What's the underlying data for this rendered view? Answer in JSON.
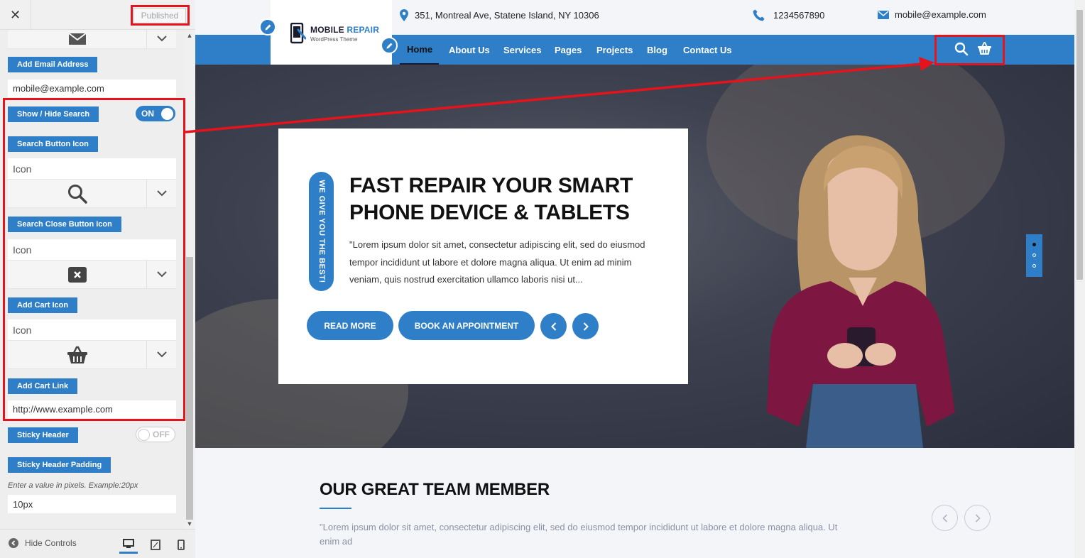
{
  "customizer": {
    "close_glyph": "✕",
    "published_label": "Published",
    "email_field_label": "Add Email Address",
    "email_value": "mobile@example.com",
    "show_hide_search_label": "Show / Hide Search",
    "search_toggle_state": "ON",
    "search_button_icon_label": "Search Button Icon",
    "search_icon_placeholder": "Icon",
    "search_close_icon_label": "Search Close Button Icon",
    "search_close_icon_placeholder": "Icon",
    "cart_icon_label": "Add Cart Icon",
    "cart_icon_placeholder": "Icon",
    "cart_link_label": "Add Cart Link",
    "cart_link_value": "http://www.example.com",
    "sticky_header_label": "Sticky Header",
    "sticky_toggle_state": "OFF",
    "sticky_padding_label": "Sticky Header Padding",
    "sticky_padding_hint": "Enter a value in pixels. Example:20px",
    "sticky_padding_value": "10px",
    "hide_controls_label": "Hide Controls",
    "accent_color": "#2e7fc8"
  },
  "site": {
    "topbar": {
      "address": "351, Montreal Ave, Statene Island, NY 10306",
      "phone": "1234567890",
      "email": "mobile@example.com"
    },
    "logo": {
      "title_part1": "MOBILE",
      "title_part2": "REPAIR",
      "subtitle": "WordPress Theme"
    },
    "nav": [
      "Home",
      "About Us",
      "Services",
      "Pages",
      "Projects",
      "Blog",
      "Contact Us"
    ],
    "nav_active": "Home",
    "hero": {
      "tag": "WE GIVE YOU THE BEST!",
      "title": "FAST REPAIR YOUR SMART PHONE DEVICE & TABLETS",
      "text": "\"Lorem ipsum dolor sit amet, consectetur adipiscing elit, sed do eiusmod tempor incididunt ut labore et dolore magna aliqua. Ut enim ad minim veniam, quis nostrud exercitation ullamco laboris nisi ut...",
      "read_more": "READ MORE",
      "book": "BOOK AN APPOINTMENT"
    },
    "team": {
      "title": "OUR GREAT TEAM MEMBER",
      "text": "\"Lorem ipsum dolor sit amet, consectetur adipiscing elit, sed do eiusmod tempor incididunt ut labore et dolore magna aliqua. Ut enim ad"
    }
  }
}
